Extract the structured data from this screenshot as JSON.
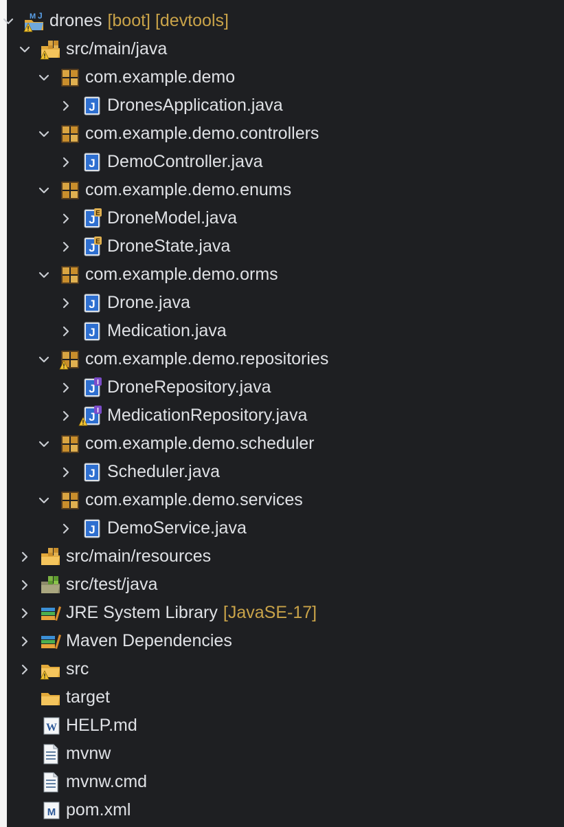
{
  "project": {
    "name": "drones",
    "decorations": "[boot] [devtools]"
  },
  "src_main_java": {
    "label": "src/main/java"
  },
  "packages": [
    {
      "label": "com.example.demo",
      "files": [
        {
          "label": "DronesApplication.java"
        }
      ]
    },
    {
      "label": "com.example.demo.controllers",
      "files": [
        {
          "label": "DemoController.java"
        }
      ]
    },
    {
      "label": "com.example.demo.enums",
      "files": [
        {
          "label": "DroneModel.java"
        },
        {
          "label": "DroneState.java"
        }
      ]
    },
    {
      "label": "com.example.demo.orms",
      "files": [
        {
          "label": "Drone.java"
        },
        {
          "label": "Medication.java"
        }
      ]
    },
    {
      "label": "com.example.demo.repositories",
      "files": [
        {
          "label": "DroneRepository.java"
        },
        {
          "label": "MedicationRepository.java"
        }
      ]
    },
    {
      "label": "com.example.demo.scheduler",
      "files": [
        {
          "label": "Scheduler.java"
        }
      ]
    },
    {
      "label": "com.example.demo.services",
      "files": [
        {
          "label": "DemoService.java"
        }
      ]
    }
  ],
  "roots": [
    {
      "label": "src/main/resources"
    },
    {
      "label": "src/test/java"
    },
    {
      "label": "JRE System Library",
      "decoration": "[JavaSE-17]"
    },
    {
      "label": "Maven Dependencies"
    },
    {
      "label": "src"
    },
    {
      "label": "target"
    },
    {
      "label": "HELP.md"
    },
    {
      "label": "mvnw"
    },
    {
      "label": "mvnw.cmd"
    },
    {
      "label": "pom.xml"
    }
  ],
  "icon_letters": {
    "maven": "M",
    "java": "J",
    "enum": "E",
    "interface": "I",
    "word": "W",
    "markdown_m": "M"
  },
  "colors": {
    "background": "#1e1f22",
    "text": "#dfe1e5",
    "decoration": "#c9a349",
    "package": "#d4a23a",
    "java_icon": "#2b6cc4",
    "warning": "#f2c230",
    "interface_badge": "#7b4cc9"
  }
}
